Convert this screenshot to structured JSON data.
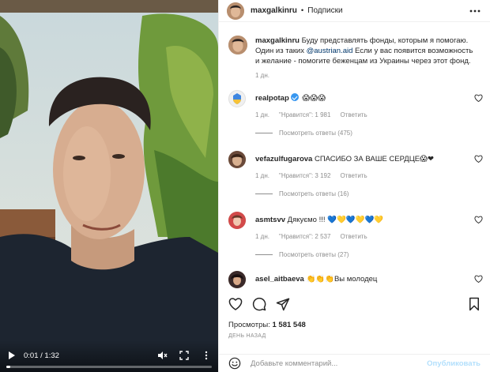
{
  "video": {
    "time": "0:01 / 1:32",
    "progress_fraction": 0.01
  },
  "header": {
    "username": "maxgalkinru",
    "separator": "•",
    "follow_label": "Подписки"
  },
  "caption": {
    "username": "maxgalkinru",
    "text_before": "Буду представлять фонды, которым я помогаю. Один из таких",
    "mention": "@austrian.aid",
    "text_after": "Если у вас появится возможность и желание - помогите беженцам из Украины через этот фонд.",
    "time": "1 дн."
  },
  "comments": [
    {
      "username": "realpotap",
      "verified": true,
      "text": "",
      "emojis": "😱😱😱",
      "time": "1 дн.",
      "likes": "\"Нравится\": 1 981",
      "reply_label": "Ответить",
      "view_replies": "Посмотреть ответы (475)"
    },
    {
      "username": "vefazulfugarova",
      "text": "СПАСИБО ЗА ВАШЕ СЕРДЦЕ",
      "emojis": "😱❤",
      "time": "1 дн.",
      "likes": "\"Нравится\": 3 192",
      "reply_label": "Ответить",
      "view_replies": "Посмотреть ответы (16)"
    },
    {
      "username": "asmtsvv",
      "text": "Дякуємо !!!",
      "emojis": "💙💛💙💛💙💛",
      "time": "1 дн.",
      "likes": "\"Нравится\": 2 537",
      "reply_label": "Ответить",
      "view_replies": "Посмотреть ответы (27)"
    },
    {
      "username": "asel_aitbaeva",
      "text": "Вы молодец",
      "emojis": "👏👏👏"
    }
  ],
  "stats": {
    "views_label": "Просмотры:",
    "views_value": "1 581 548",
    "posted_ago": "ДЕНЬ НАЗАД"
  },
  "composer": {
    "placeholder": "Добавьте комментарий...",
    "publish_label": "Опубликовать"
  },
  "colors": {
    "link": "#00376b",
    "muted": "#8e8e8e",
    "publish_disabled": "#b2dffc",
    "verified": "#3897f0"
  }
}
